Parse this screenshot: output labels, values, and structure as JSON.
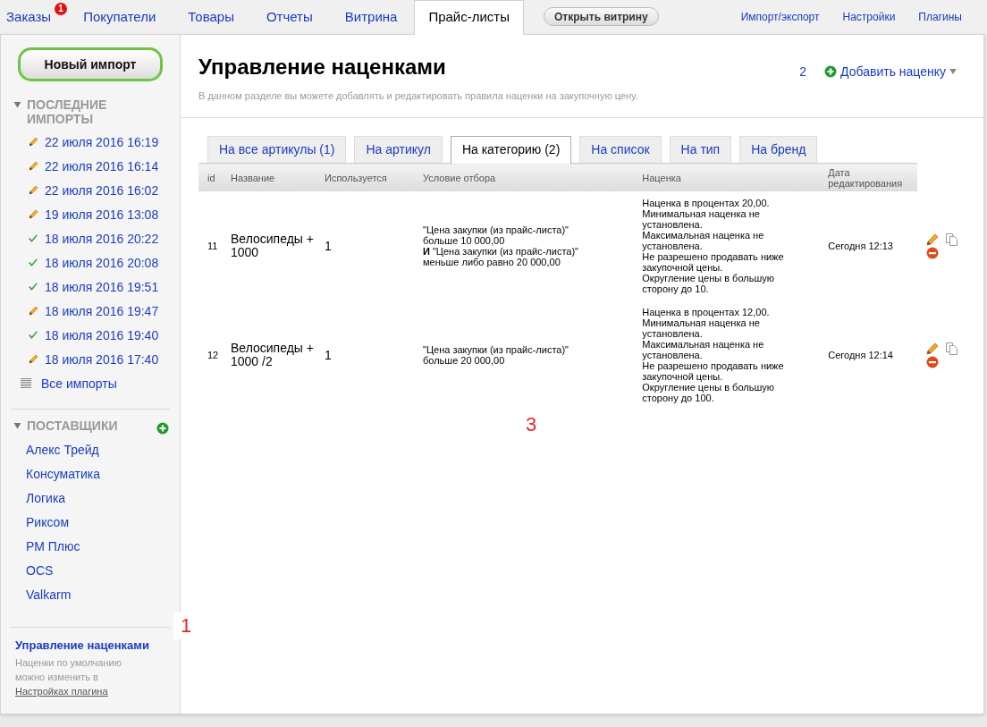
{
  "top_nav": {
    "tabs": [
      {
        "label": "Заказы",
        "selected": false,
        "badge": "1"
      },
      {
        "label": "Покупатели",
        "selected": false
      },
      {
        "label": "Товары",
        "selected": false
      },
      {
        "label": "Отчеты",
        "selected": false
      },
      {
        "label": "Витрина",
        "selected": false
      },
      {
        "label": "Прайс-листы",
        "selected": true
      }
    ],
    "storefront_button": "Открыть витрину",
    "links": [
      "Импорт/экспорт",
      "Настройки",
      "Плагины"
    ]
  },
  "sidebar": {
    "new_import_button": "Новый импорт",
    "recent_imports": {
      "title": "ПОСЛЕДНИЕ ИМПОРТЫ",
      "expanded": true,
      "items": [
        {
          "label": "22 июля 2016 16:19",
          "kind": "draft"
        },
        {
          "label": "22 июля 2016 16:14",
          "kind": "draft"
        },
        {
          "label": "22 июля 2016 16:02",
          "kind": "draft"
        },
        {
          "label": "19 июля 2016 13:08",
          "kind": "draft"
        },
        {
          "label": "18 июля 2016 20:22",
          "kind": "done"
        },
        {
          "label": "18 июля 2016 20:08",
          "kind": "done"
        },
        {
          "label": "18 июля 2016 19:51",
          "kind": "done"
        },
        {
          "label": "18 июля 2016 19:47",
          "kind": "draft"
        },
        {
          "label": "18 июля 2016 19:40",
          "kind": "done"
        },
        {
          "label": "18 июля 2016 17:40",
          "kind": "draft"
        }
      ],
      "all_link": "Все импорты"
    },
    "suppliers": {
      "title": "ПОСТАВЩИКИ",
      "expanded": true,
      "items": [
        "Алекс Трейд",
        "Консуматика",
        "Логика",
        "Риксом",
        "РМ Плюс",
        "OCS",
        "Valkarm"
      ]
    },
    "markup_link": "Управление наценками",
    "note": "Наценки по умолчанию можно изменить в",
    "note_link": "Настройках плагина"
  },
  "content": {
    "title": "Управление наценками",
    "subtitle": "В данном разделе вы можете добавлять и редактировать правила наценки на закупочную цену.",
    "add_button": "Добавить наценку",
    "tabs": [
      {
        "label": "На все артикулы (1)",
        "selected": false
      },
      {
        "label": "На артикул",
        "selected": false
      },
      {
        "label": "На категорию (2)",
        "selected": true
      },
      {
        "label": "На список",
        "selected": false
      },
      {
        "label": "На тип",
        "selected": false
      },
      {
        "label": "На бренд",
        "selected": false
      }
    ],
    "table": {
      "columns": [
        "id",
        "Название",
        "Используется",
        "Условие отбора",
        "Наценка",
        "Дата редактирования"
      ],
      "rows": [
        {
          "id": "11",
          "name": "Велосипеды + 1000",
          "used": "1",
          "condition": [
            "\"Цена закупки (из прайс-листа)\" больше 10 000,00",
            "**И** \"Цена закупки (из прайс-листа)\" меньше либо равно 20 000,00"
          ],
          "markup": [
            "Наценка в процентах 20,00.",
            "Минимальная наценка не установлена.",
            "Максимальная наценка не установлена.",
            "Не разрешено продавать ниже закупочной цены.",
            "Округление цены в большую сторону до 10."
          ],
          "edited": "Сегодня 12:13"
        },
        {
          "id": "12",
          "name": "Велосипеды + 1000 /2",
          "used": "1",
          "condition": [
            "\"Цена закупки (из прайс-листа)\" больше 20 000,00"
          ],
          "markup": [
            "Наценка в процентах 12,00.",
            "Минимальная наценка не установлена.",
            "Максимальная наценка не установлена.",
            "Не разрешено продавать ниже закупочной цены.",
            "Округление цены в большую сторону до 100."
          ],
          "edited": "Сегодня 12:14"
        }
      ]
    }
  },
  "annotations": [
    "1",
    "2",
    "3"
  ]
}
